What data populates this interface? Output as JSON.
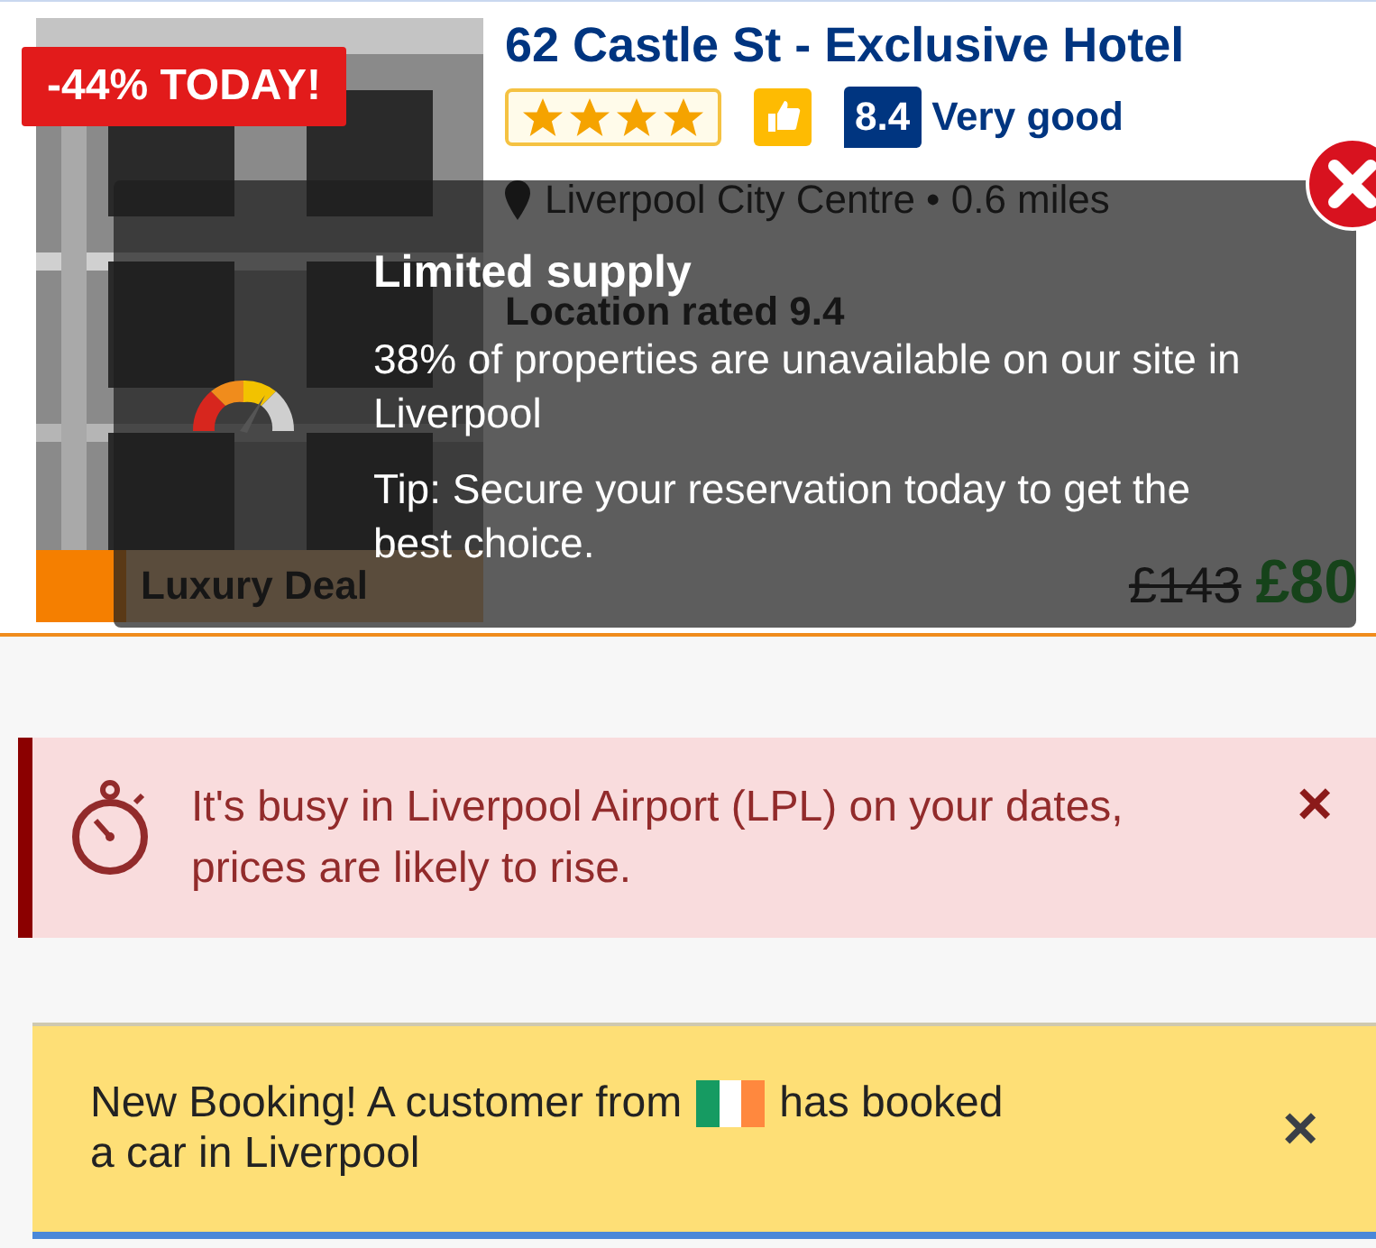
{
  "hotel": {
    "discount_badge": "-44% TODAY!",
    "title": "62 Castle St - Exclusive Hotel",
    "stars": 4,
    "score": "8.4",
    "score_label": "Very good",
    "location": "Liverpool City Centre • 0.6 miles",
    "location_rating": "Location rated 9.4",
    "deal": "Luxury Deal",
    "old_price": "£143",
    "price": "£80"
  },
  "tooltip": {
    "title": "Limited supply",
    "message": "38% of properties are unavailable on our site in Liverpool",
    "tip": "Tip: Secure your reservation today to get the best choice."
  },
  "alert": {
    "text": "It's busy in Liverpool Airport (LPL) on your dates, prices are likely to rise.",
    "close": "×"
  },
  "booking": {
    "text_before": "New Booking! A customer from",
    "text_after": "has booked",
    "line_2": "a car in Liverpool",
    "close": "×"
  }
}
